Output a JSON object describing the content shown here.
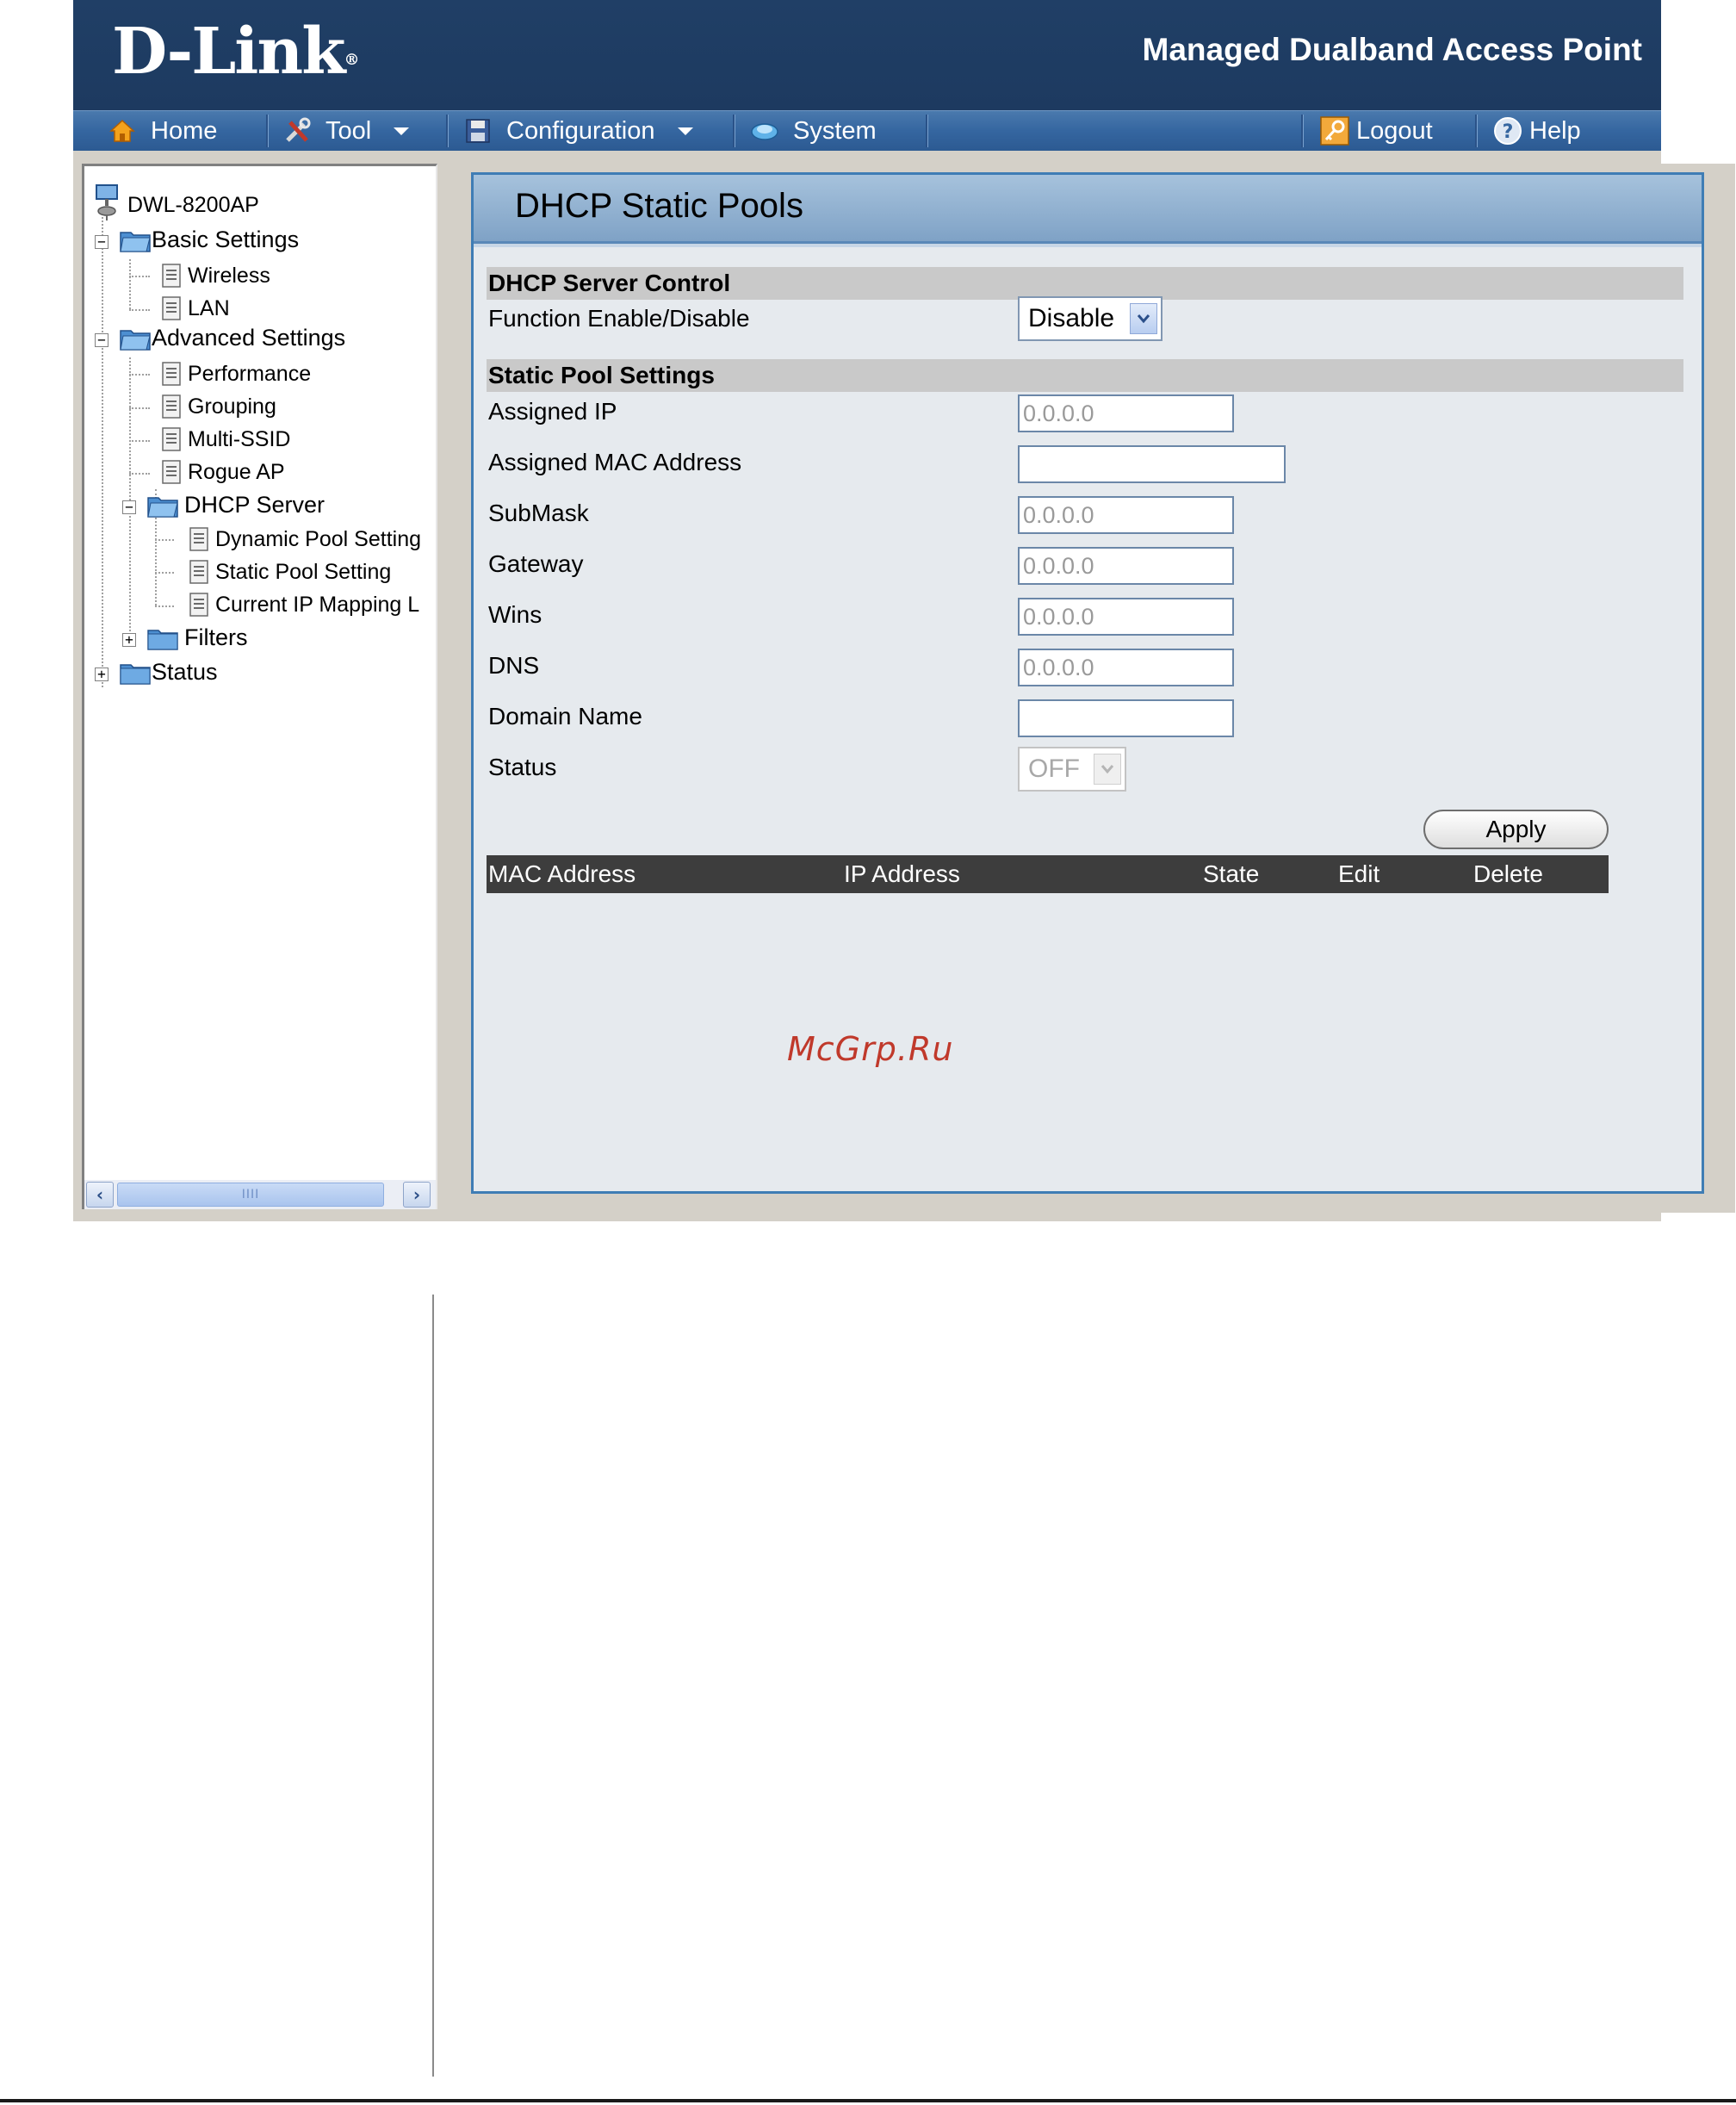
{
  "header": {
    "logo": "D-Link",
    "trademark": "®",
    "product_name": "Managed Dualband Access Point"
  },
  "menu": {
    "home": "Home",
    "tool": "Tool",
    "configuration": "Configuration",
    "system": "System",
    "logout": "Logout",
    "help": "Help"
  },
  "tree": {
    "root": "DWL-8200AP",
    "basic_settings": "Basic Settings",
    "wireless": "Wireless",
    "lan": "LAN",
    "advanced_settings": "Advanced Settings",
    "performance": "Performance",
    "grouping": "Grouping",
    "multi_ssid": "Multi-SSID",
    "rogue_ap": "Rogue AP",
    "dhcp_server": "DHCP Server",
    "dynamic_pool": "Dynamic Pool Setting",
    "static_pool": "Static Pool Setting",
    "current_ip": "Current IP Mapping L",
    "filters": "Filters",
    "status": "Status",
    "scroll_grip": "IIII"
  },
  "page": {
    "title": "DHCP Static Pools",
    "section_control": "DHCP Server Control",
    "function_label": "Function Enable/Disable",
    "function_value": "Disable",
    "section_static": "Static Pool Settings",
    "assigned_ip_label": "Assigned IP",
    "assigned_ip_value": "0.0.0.0",
    "assigned_mac_label": "Assigned MAC Address",
    "assigned_mac_value": "",
    "submask_label": "SubMask",
    "submask_value": "0.0.0.0",
    "gateway_label": "Gateway",
    "gateway_value": "0.0.0.0",
    "wins_label": "Wins",
    "wins_value": "0.0.0.0",
    "dns_label": "DNS",
    "dns_value": "0.0.0.0",
    "domain_label": "Domain Name",
    "domain_value": "",
    "status_label": "Status",
    "status_value": "OFF",
    "apply_label": "Apply",
    "table_headers": [
      "MAC Address",
      "IP Address",
      "State",
      "Edit",
      "Delete"
    ]
  },
  "watermark": "McGrp.Ru",
  "colors": {
    "header_bg": "#1d3a60",
    "menubar_bg": "#3566a0",
    "panel_border": "#3f7db5",
    "table_head": "#3d3d3d"
  }
}
